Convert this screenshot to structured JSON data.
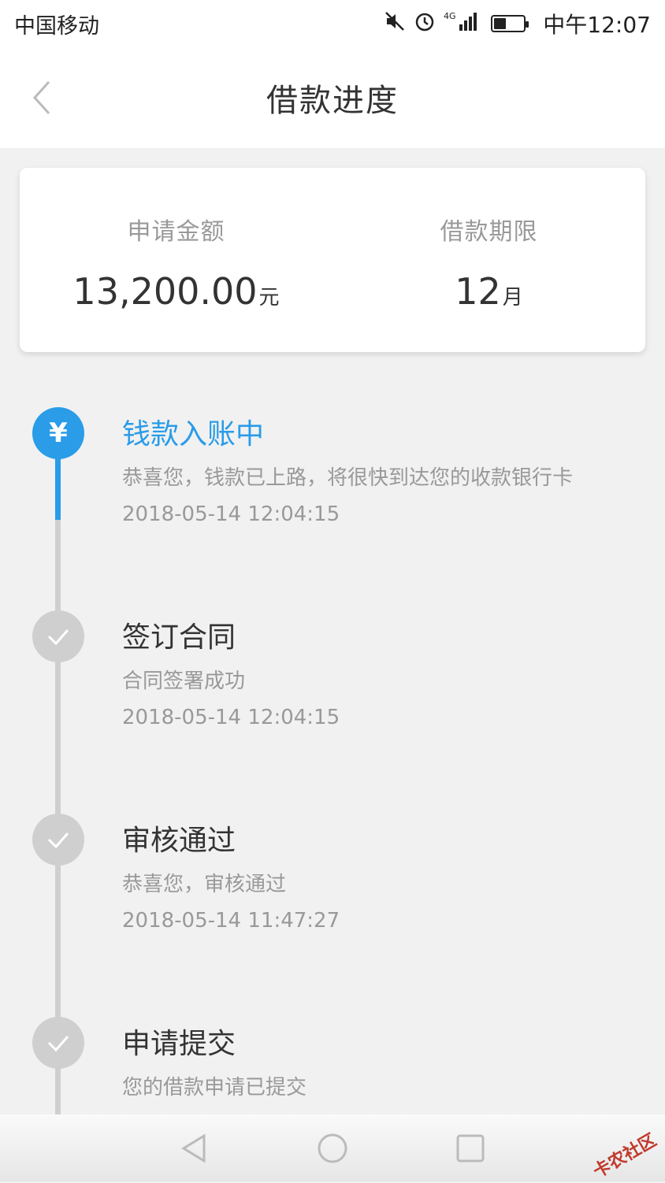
{
  "statusbar": {
    "carrier": "中国移动",
    "network": "4G",
    "time": "中午12:07",
    "battery_level": 0.4
  },
  "navbar": {
    "title": "借款进度"
  },
  "summary": {
    "amount_label": "申请金额",
    "amount_value": "13,200.00",
    "amount_unit": "元",
    "term_label": "借款期限",
    "term_value": "12",
    "term_unit": "月"
  },
  "steps": [
    {
      "title": "钱款入账中",
      "desc": "恭喜您，钱款已上路，将很快到达您的收款银行卡",
      "time": "2018-05-14 12:04:15",
      "status": "active",
      "icon": "¥"
    },
    {
      "title": "签订合同",
      "desc": "合同签署成功",
      "time": "2018-05-14 12:04:15",
      "status": "done",
      "icon": "check-icon"
    },
    {
      "title": "审核通过",
      "desc": "恭喜您，审核通过",
      "time": "2018-05-14 11:47:27",
      "status": "done",
      "icon": "check-icon"
    },
    {
      "title": "申请提交",
      "desc": "您的借款申请已提交",
      "time": "",
      "status": "done",
      "icon": "check-icon"
    }
  ],
  "watermark": "卡农社区",
  "colors": {
    "accent": "#2a9ce8",
    "inactive": "#cfcfcf"
  }
}
